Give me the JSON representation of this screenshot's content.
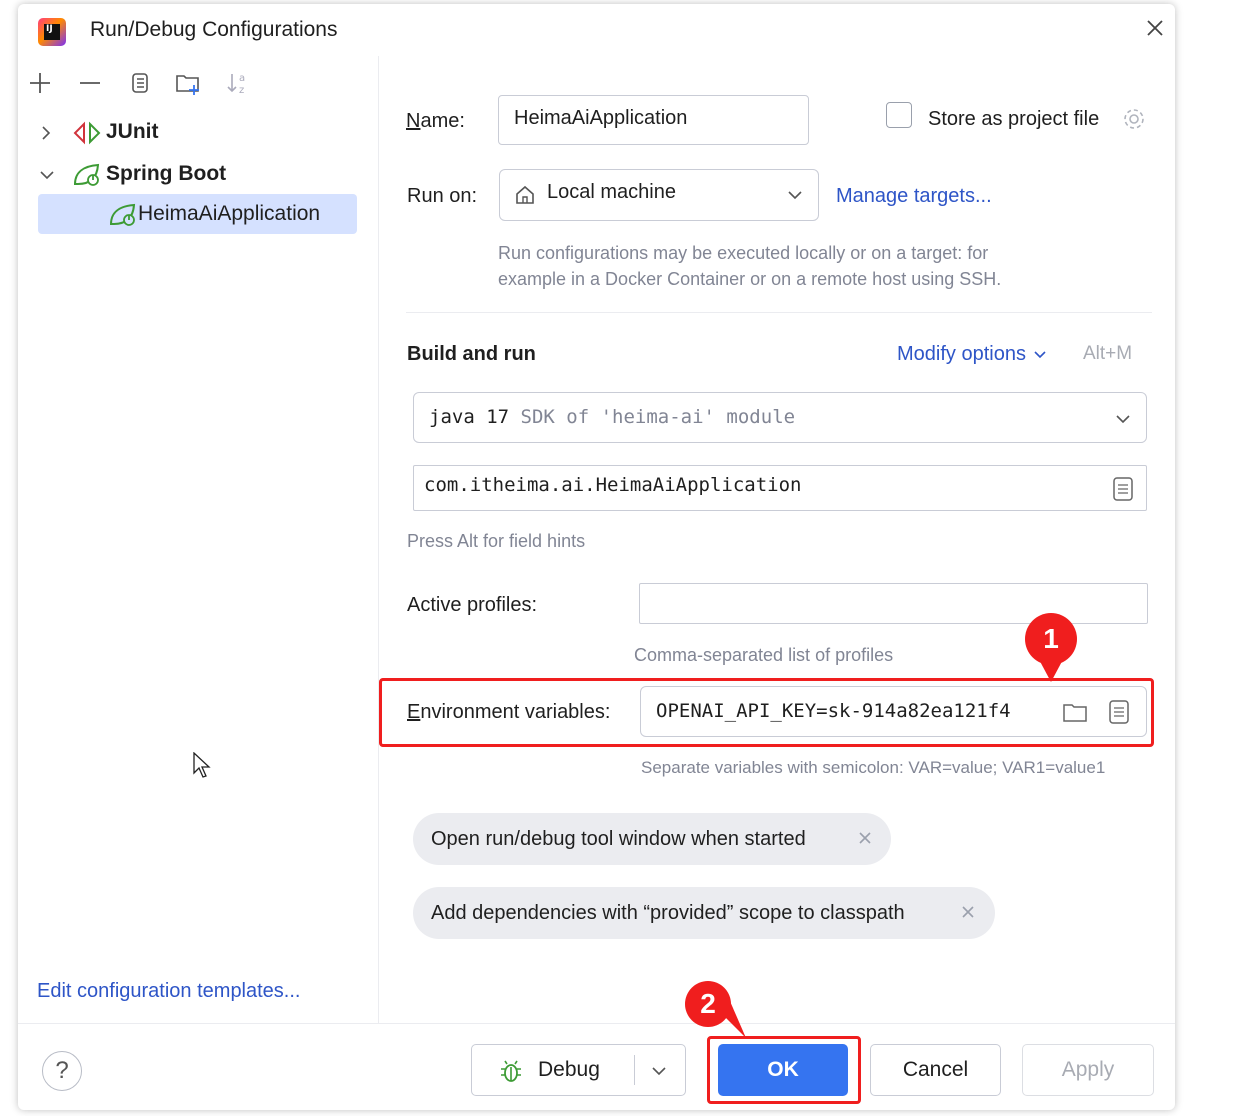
{
  "window": {
    "title": "Run/Debug Configurations",
    "close_icon": "close-icon"
  },
  "sidebar": {
    "toolbar": [
      "add-icon",
      "remove-icon",
      "copy-icon",
      "new-folder-icon",
      "sort-icon"
    ],
    "tree": [
      {
        "label": "JUnit",
        "icon": "junit-icon",
        "expanded": false,
        "bold": true
      },
      {
        "label": "Spring Boot",
        "icon": "spring-boot-icon",
        "expanded": true,
        "bold": true
      },
      {
        "label": "HeimaAiApplication",
        "icon": "spring-boot-icon",
        "selected": true
      }
    ],
    "edit_templates": "Edit configuration templates..."
  },
  "form": {
    "name_label": "Name:",
    "name_value": "HeimaAiApplication",
    "store_as_project_file": "Store as project file",
    "run_on_label": "Run on:",
    "run_on_value": "Local machine",
    "manage_targets": "Manage targets...",
    "run_on_hint_1": "Run configurations may be executed locally or on a target: for",
    "run_on_hint_2": "example in a Docker Container or on a remote host using SSH.",
    "build_and_run": "Build and run",
    "modify_options": "Modify options",
    "modify_shortcut": "Alt+M",
    "sdk_main": "java 17",
    "sdk_detail": "SDK of 'heima-ai' module",
    "main_class": "com.itheima.ai.HeimaAiApplication",
    "field_hints": "Press Alt for field hints",
    "active_profiles_label": "Active profiles:",
    "active_profiles_value": "",
    "active_profiles_hint": "Comma-separated list of profiles",
    "env_label": "Environment variables:",
    "env_value": "OPENAI_API_KEY=sk-914a82ea121f4",
    "env_hint": "Separate variables with semicolon: VAR=value; VAR1=value1",
    "options": [
      "Open run/debug tool window when started",
      "Add dependencies with “provided” scope to classpath"
    ]
  },
  "footer": {
    "help": "?",
    "debug": "Debug",
    "ok": "OK",
    "cancel": "Cancel",
    "apply": "Apply"
  },
  "annotations": {
    "marker_1": "1",
    "marker_2": "2",
    "color": "#f01e1e"
  },
  "colors": {
    "accent": "#3574f0",
    "link": "#2e55c7",
    "selection": "#d5e1ff",
    "spring_green": "#3d9b35",
    "junit_red": "#d1343c"
  }
}
